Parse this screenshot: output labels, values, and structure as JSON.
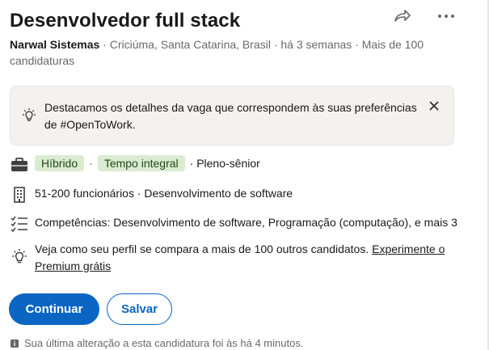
{
  "job": {
    "title": "Desenvolvedor full stack",
    "company": "Narwal Sistemas",
    "meta_rest": " · Criciúma, Santa Catarina, Brasil · há 3 semanas · Mais de 100 candidaturas"
  },
  "actions": {
    "share_icon": "share-arrow",
    "more_icon": "ellipsis"
  },
  "banner": {
    "text": "Destacamos os detalhes da vaga que correspondem às suas preferências de #OpenToWork.",
    "icon": "lightbulb"
  },
  "details": {
    "workplace": "Híbrido",
    "type": "Tempo integral",
    "level_text": "· Pleno-sênior",
    "company_info": "51-200 funcionários · Desenvolvimento de software",
    "skills": "Competências: Desenvolvimento de software, Programação (computação), e mais 3",
    "premium_text": "Veja como seu perfil se compara a mais de 100 outros candidatos.",
    "premium_link": "Experimente o Premium grátis"
  },
  "buttons": {
    "continue": "Continuar",
    "save": "Salvar"
  },
  "footnote": "Sua última alteração a esta candidatura foi às há 4 minutos.",
  "colors": {
    "primary": "#0a66c2",
    "pill_bg": "#daebd1",
    "pill_text": "#1f4b16",
    "banner_bg": "#f4f2ee"
  }
}
